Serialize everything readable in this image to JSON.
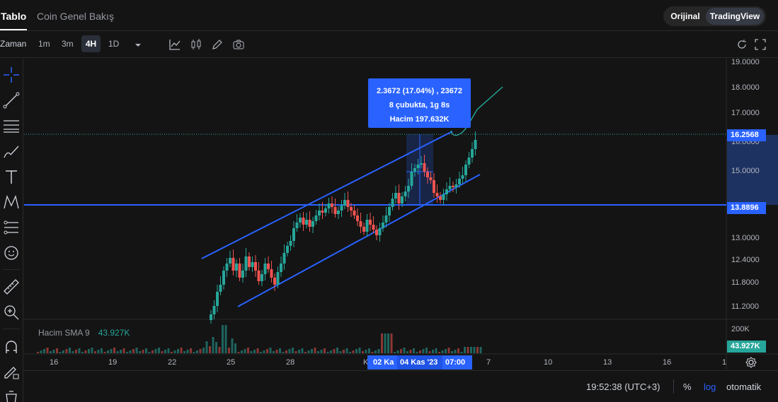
{
  "header": {
    "tabs": [
      {
        "label": "Tablo",
        "active": true
      },
      {
        "label": "Coin Genel Bakış",
        "active": false
      }
    ],
    "view_switch": {
      "options": [
        "Orijinal",
        "TradingView"
      ],
      "selected": "TradingView"
    }
  },
  "toolbar": {
    "time_label": "Zaman",
    "intervals": [
      "1m",
      "3m",
      "4H",
      "1D"
    ],
    "selected_interval": "4H",
    "icons": [
      "chevron-down-icon",
      "indicators-icon",
      "candle-type-icon",
      "pencil-icon",
      "camera-icon",
      "reset-icon",
      "fullscreen-icon"
    ]
  },
  "left_tools": [
    "crosshair-icon",
    "trend-line-icon",
    "horizontal-lines-icon",
    "brush-icon",
    "text-icon",
    "pattern-icon",
    "fib-icon",
    "emoji-icon",
    "ruler-icon",
    "zoom-in-icon",
    "magnet-icon",
    "lock-pencil-icon"
  ],
  "chart": {
    "price_axis": [
      "19.0000",
      "18.0000",
      "17.0000",
      "16.0000",
      "15.0000",
      "13.0000",
      "12.4000",
      "11.8000",
      "11.2000"
    ],
    "current_price": "16.2568",
    "horizontal_line_price": "13.8896",
    "volume_axis_label": "200K",
    "volume_tag": "43.927K",
    "time_axis": [
      "16",
      "19",
      "22",
      "25",
      "28",
      "7",
      "10",
      "13",
      "16",
      "1"
    ],
    "time_axis_partial": "K",
    "selected_range": {
      "start": "02 Ka",
      "mid": "04 Kas '23",
      "end": "07:00"
    },
    "measure_tooltip": {
      "line1": "2.3672 (17.04%) , 23672",
      "line2": "8 çubukta, 1g 8s",
      "line3": "Hacim 197.632K"
    },
    "volume_legend": {
      "label": "Hacim SMA 9",
      "value": "43.927K"
    },
    "colors": {
      "up": "#26a69a",
      "down": "#ef5350",
      "accent": "#2962ff",
      "background": "#141414"
    }
  },
  "footer": {
    "time": "19:52:38 (UTC+3)",
    "percent": "%",
    "log": "log",
    "auto": "otomatik"
  }
}
